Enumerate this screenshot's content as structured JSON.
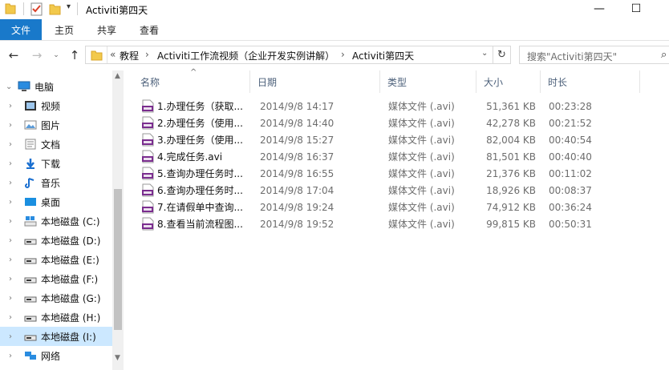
{
  "window": {
    "title": "Activiti第四天",
    "minimize": "—",
    "maximize": "☐"
  },
  "ribbon": {
    "tabs": [
      "文件",
      "主页",
      "共享",
      "查看"
    ]
  },
  "address": {
    "prefix": "«",
    "crumbs": [
      "教程",
      "Activiti工作流视频（企业开发实例讲解）",
      "Activiti第四天"
    ],
    "search_placeholder": "搜索\"Activiti第四天\""
  },
  "nav": {
    "items": [
      {
        "label": "电脑",
        "icon": "computer-icon",
        "selected": false
      },
      {
        "label": "视频",
        "icon": "video-folder-icon",
        "selected": false
      },
      {
        "label": "图片",
        "icon": "pictures-folder-icon",
        "selected": false
      },
      {
        "label": "文档",
        "icon": "documents-folder-icon",
        "selected": false
      },
      {
        "label": "下载",
        "icon": "downloads-folder-icon",
        "selected": false
      },
      {
        "label": "音乐",
        "icon": "music-folder-icon",
        "selected": false
      },
      {
        "label": "桌面",
        "icon": "desktop-folder-icon",
        "selected": false
      },
      {
        "label": "本地磁盘 (C:)",
        "icon": "system-drive-icon",
        "selected": false
      },
      {
        "label": "本地磁盘 (D:)",
        "icon": "drive-icon",
        "selected": false
      },
      {
        "label": "本地磁盘 (E:)",
        "icon": "drive-icon",
        "selected": false
      },
      {
        "label": "本地磁盘 (F:)",
        "icon": "drive-icon",
        "selected": false
      },
      {
        "label": "本地磁盘 (G:)",
        "icon": "drive-icon",
        "selected": false
      },
      {
        "label": "本地磁盘 (H:)",
        "icon": "drive-icon",
        "selected": false
      },
      {
        "label": "本地磁盘 (I:)",
        "icon": "drive-icon",
        "selected": true
      },
      {
        "label": "网络",
        "icon": "network-icon",
        "selected": false
      }
    ]
  },
  "columns": {
    "name": "名称",
    "date": "日期",
    "type": "类型",
    "size": "大小",
    "duration": "时长"
  },
  "files": [
    {
      "name": "1.办理任务（获取...",
      "date": "2014/9/8 14:17",
      "type": "媒体文件 (.avi)",
      "size": "51,361 KB",
      "duration": "00:23:28"
    },
    {
      "name": "2.办理任务（使用...",
      "date": "2014/9/8 14:40",
      "type": "媒体文件 (.avi)",
      "size": "42,278 KB",
      "duration": "00:21:52"
    },
    {
      "name": "3.办理任务（使用...",
      "date": "2014/9/8 15:27",
      "type": "媒体文件 (.avi)",
      "size": "82,004 KB",
      "duration": "00:40:54"
    },
    {
      "name": "4.完成任务.avi",
      "date": "2014/9/8 16:37",
      "type": "媒体文件 (.avi)",
      "size": "81,501 KB",
      "duration": "00:40:40"
    },
    {
      "name": "5.查询办理任务时...",
      "date": "2014/9/8 16:55",
      "type": "媒体文件 (.avi)",
      "size": "21,376 KB",
      "duration": "00:11:02"
    },
    {
      "name": "6.查询办理任务时...",
      "date": "2014/9/8 17:04",
      "type": "媒体文件 (.avi)",
      "size": "18,926 KB",
      "duration": "00:08:37"
    },
    {
      "name": "7.在请假单中查询...",
      "date": "2014/9/8 19:24",
      "type": "媒体文件 (.avi)",
      "size": "74,912 KB",
      "duration": "00:36:24"
    },
    {
      "name": "8.查看当前流程图...",
      "date": "2014/9/8 19:52",
      "type": "媒体文件 (.avi)",
      "size": "99,815 KB",
      "duration": "00:50:31"
    }
  ],
  "colors": {
    "accent": "#1979ca",
    "selection": "#cce8ff",
    "header_text": "#4c607a",
    "secondary_text": "#6d6d6d"
  }
}
